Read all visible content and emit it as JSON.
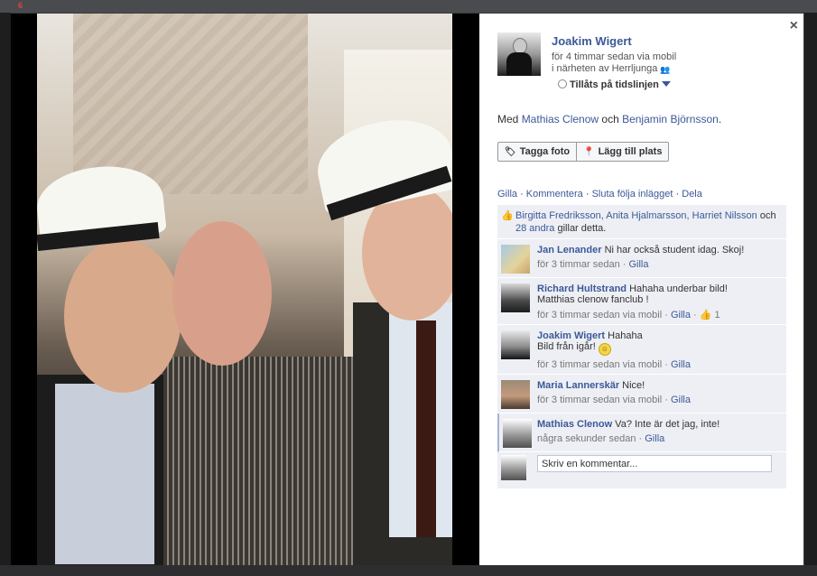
{
  "post": {
    "owner_name": "Joakim Wigert",
    "time_line": "för 4 timmar sedan via mobil",
    "location_line": "i närheten av Herrljunga",
    "timeline_toggle": "Tillåts på tidslinjen",
    "with_prefix": "Med ",
    "with_person_1": "Mathias Clenow",
    "with_and": " och ",
    "with_person_2": "Benjamin Björnsson",
    "with_suffix": "."
  },
  "photo_buttons": {
    "tag_label": "Tagga foto",
    "place_label": "Lägg till plats"
  },
  "actions": {
    "like": "Gilla",
    "comment": "Kommentera",
    "unfollow": "Sluta följa inlägget",
    "share": "Dela",
    "sep": " · "
  },
  "likes": {
    "names": "Birgitta Fredriksson, Anita Hjalmarsson, Harriet Nilsson",
    "and": " och ",
    "others": "28 andra",
    "suffix": " gillar detta."
  },
  "comments": [
    {
      "author": "Jan Lenander",
      "text": " Ni har också student idag. Skoj!",
      "text2": "",
      "meta": "för 3 timmar sedan · ",
      "like_label": "Gilla",
      "like_count": "",
      "avatar": "jan"
    },
    {
      "author": "Richard Hultstrand",
      "text": " Hahaha underbar bild!",
      "text2": "Matthias clenow fanclub !",
      "meta": "för 3 timmar sedan via mobil · ",
      "like_label": "Gilla",
      "like_count": "1",
      "avatar": "richard"
    },
    {
      "author": "Joakim Wigert",
      "text": " Hahaha",
      "text2": "Bild från igår!",
      "meta": "för 3 timmar sedan via mobil · ",
      "like_label": "Gilla",
      "like_count": "",
      "avatar": "joakim"
    },
    {
      "author": "Maria Lannerskär",
      "text": " Nice!",
      "text2": "",
      "meta": "för 3 timmar sedan via mobil · ",
      "like_label": "Gilla",
      "like_count": "",
      "avatar": "maria"
    },
    {
      "author": "Mathias Clenow",
      "text": " Va? Inte är det jag, inte!",
      "text2": "",
      "meta": "några sekunder sedan · ",
      "like_label": "Gilla",
      "like_count": "",
      "avatar": "mathias"
    }
  ],
  "write_comment": {
    "placeholder": "Skriv en kommentar..."
  },
  "icons": {
    "close": "close-icon",
    "tag": "tag-icon",
    "place": "location-pin-icon",
    "thumb": "thumbs-up-icon",
    "people": "people-icon",
    "smiley": "smiley-icon"
  },
  "colors": {
    "link": "#3b5998",
    "feedback_bg": "#edeff4",
    "backdrop": "#3a3b3d"
  },
  "notification_count": "6"
}
